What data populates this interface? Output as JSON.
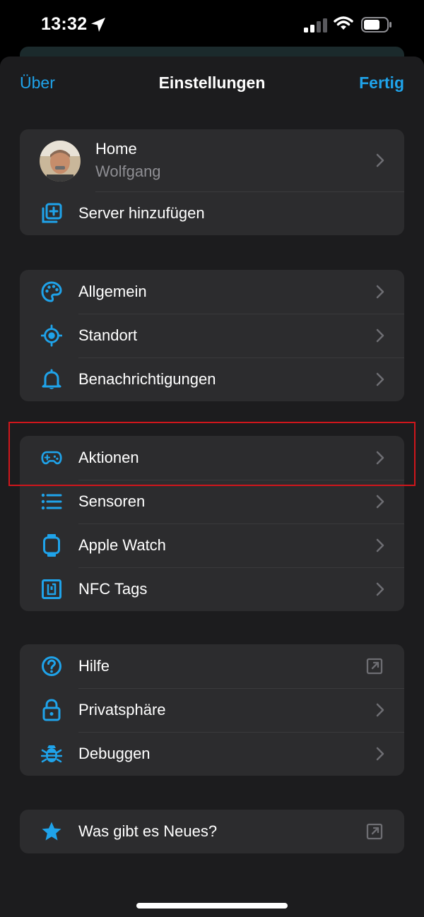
{
  "status_bar": {
    "time": "13:32"
  },
  "nav": {
    "left": "Über",
    "title": "Einstellungen",
    "right": "Fertig"
  },
  "account": {
    "server": "Home",
    "user": "Wolfgang",
    "add_server": "Server hinzufügen"
  },
  "group1": [
    {
      "label": "Allgemein",
      "icon": "palette-icon"
    },
    {
      "label": "Standort",
      "icon": "location-crosshair-icon"
    },
    {
      "label": "Benachrichtigungen",
      "icon": "bell-icon"
    }
  ],
  "group2": [
    {
      "label": "Aktionen",
      "icon": "gamepad-icon"
    },
    {
      "label": "Sensoren",
      "icon": "list-icon"
    },
    {
      "label": "Apple Watch",
      "icon": "watch-icon"
    },
    {
      "label": "NFC Tags",
      "icon": "nfc-icon"
    }
  ],
  "group3": [
    {
      "label": "Hilfe",
      "icon": "help-circle-icon"
    },
    {
      "label": "Privatsphäre",
      "icon": "lock-icon"
    },
    {
      "label": "Debuggen",
      "icon": "bug-icon"
    }
  ],
  "group4": [
    {
      "label": "Was gibt es Neues?",
      "icon": "star-icon"
    }
  ],
  "colors": {
    "accent": "#1fa3ea",
    "sheet": "#1c1c1e",
    "cell": "#2c2c2e",
    "highlight": "#d0161c"
  }
}
